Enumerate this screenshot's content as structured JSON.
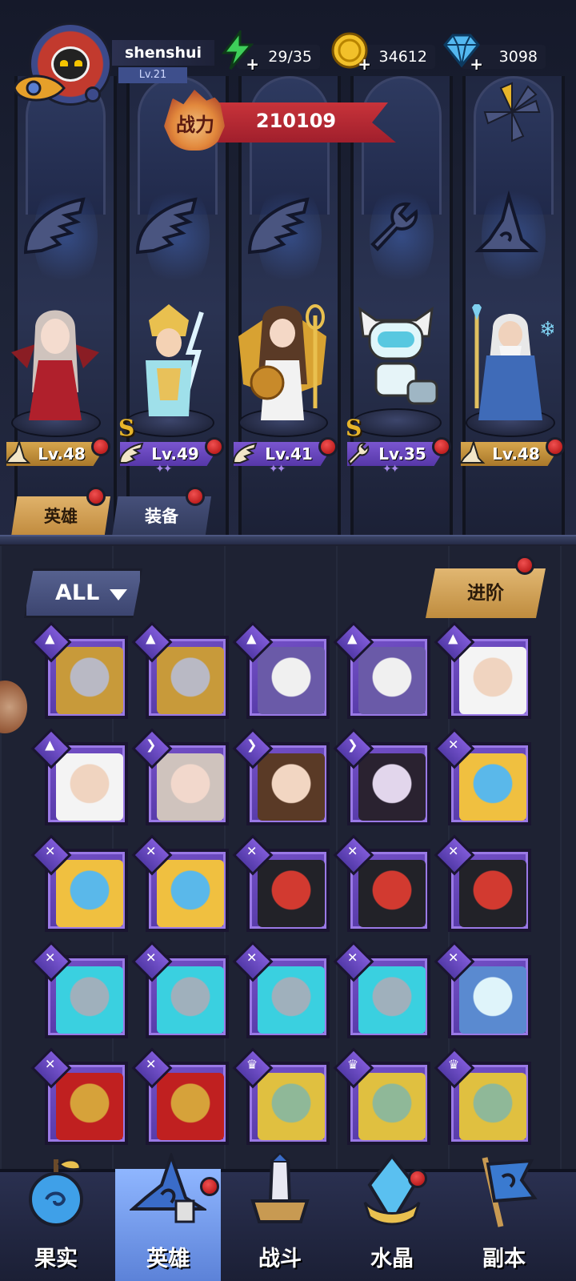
{
  "player": {
    "name": "shenshui",
    "level": "Lv.21"
  },
  "resources": {
    "energy": "29/35",
    "gold": "34612",
    "diamonds": "3098"
  },
  "power": {
    "label": "战力",
    "value": "210109"
  },
  "heroes": [
    {
      "level": "Lv.48",
      "class_icon": "mage-hat-icon",
      "plate_color": "#c8963c",
      "rank": ""
    },
    {
      "level": "Lv.49",
      "class_icon": "wing-icon",
      "plate_color": "#6a4ac0",
      "rank": "S"
    },
    {
      "level": "Lv.41",
      "class_icon": "wing-icon",
      "plate_color": "#6a4ac0",
      "rank": ""
    },
    {
      "level": "Lv.35",
      "class_icon": "wrench-icon",
      "plate_color": "#6a4ac0",
      "rank": "S"
    },
    {
      "level": "Lv.48",
      "class_icon": "mage-hat-icon",
      "plate_color": "#c8963c",
      "rank": ""
    }
  ],
  "tabs": {
    "heroes": "英雄",
    "equipment": "装备"
  },
  "filter": {
    "selected": "ALL"
  },
  "advance_button": "进阶",
  "grid_cards": [
    {
      "type": "mage-hat-icon",
      "portrait": "knight"
    },
    {
      "type": "mage-hat-icon",
      "portrait": "knight"
    },
    {
      "type": "mage-hat-icon",
      "portrait": "nun"
    },
    {
      "type": "mage-hat-icon",
      "portrait": "nun"
    },
    {
      "type": "mage-hat-icon",
      "portrait": "old-wizard"
    },
    {
      "type": "mage-hat-icon",
      "portrait": "old-wizard"
    },
    {
      "type": "wing-icon",
      "portrait": "vampire-lady"
    },
    {
      "type": "wing-icon",
      "portrait": "goddess"
    },
    {
      "type": "wing-icon",
      "portrait": "gothic-girl"
    },
    {
      "type": "wrench-icon",
      "portrait": "fish-robot"
    },
    {
      "type": "wrench-icon",
      "portrait": "fish-robot"
    },
    {
      "type": "wrench-icon",
      "portrait": "fish-robot"
    },
    {
      "type": "wrench-icon",
      "portrait": "diver-robot"
    },
    {
      "type": "wrench-icon",
      "portrait": "diver-robot"
    },
    {
      "type": "wrench-icon",
      "portrait": "diver-robot"
    },
    {
      "type": "wrench-icon",
      "portrait": "visor-robot"
    },
    {
      "type": "wrench-icon",
      "portrait": "visor-robot"
    },
    {
      "type": "wrench-icon",
      "portrait": "visor-robot"
    },
    {
      "type": "wrench-icon",
      "portrait": "visor-robot"
    },
    {
      "type": "wrench-icon",
      "portrait": "ghost-capsule"
    },
    {
      "type": "wrench-icon",
      "portrait": "cyclops-robot"
    },
    {
      "type": "wrench-icon",
      "portrait": "cyclops-robot"
    },
    {
      "type": "beast-icon",
      "portrait": "green-queen"
    },
    {
      "type": "beast-icon",
      "portrait": "green-queen"
    },
    {
      "type": "beast-icon",
      "portrait": "green-queen"
    }
  ],
  "bottom_nav": [
    {
      "label": "果实",
      "icon": "fruit-icon"
    },
    {
      "label": "英雄",
      "icon": "hero-hat-icon"
    },
    {
      "label": "战斗",
      "icon": "battle-icon"
    },
    {
      "label": "水晶",
      "icon": "crystal-icon"
    },
    {
      "label": "副本",
      "icon": "dungeon-flag-icon"
    }
  ],
  "colors": {
    "gold_plate": "#c8963c",
    "purple_plate": "#6a4ac0",
    "red_dot": "#d63030",
    "card_purple": "#5c3db0",
    "active_tab": "#e0b26a"
  }
}
